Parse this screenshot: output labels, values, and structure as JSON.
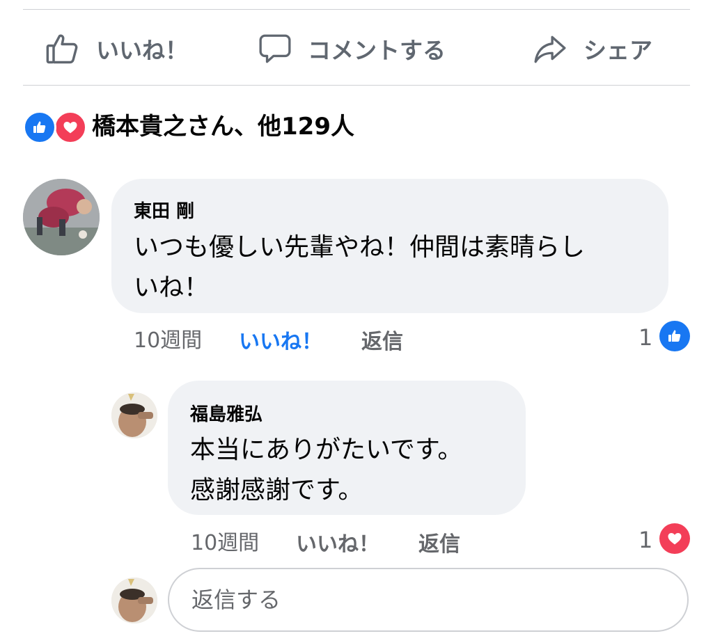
{
  "actions": {
    "like_label": "いいね！",
    "comment_label": "コメントする",
    "share_label": "シェア"
  },
  "reactions_summary": {
    "text": "橋本貴之さん、他129人",
    "icons": [
      "like-icon",
      "love-icon"
    ]
  },
  "comments": [
    {
      "author": "東田 剛",
      "lines": [
        "いつも優しい先輩やね！仲間は素晴らし",
        "いね！"
      ],
      "time": "10週間",
      "like_label": "いいね！",
      "reply_label": "返信",
      "reaction_count": "1",
      "reaction_icon": "like-icon",
      "liked": true
    },
    {
      "author": "福島雅弘",
      "lines": [
        "本当にありがたいです。",
        "感謝感謝です。"
      ],
      "time": "10週間",
      "like_label": "いいね！",
      "reply_label": "返信",
      "reaction_count": "1",
      "reaction_icon": "love-icon",
      "liked": false
    }
  ],
  "reply_box": {
    "placeholder": "返信する"
  },
  "colors": {
    "like_blue": "#1877f2",
    "love_red": "#f33e58",
    "bubble_gray": "#f0f2f5",
    "meta_gray": "#65676b"
  }
}
